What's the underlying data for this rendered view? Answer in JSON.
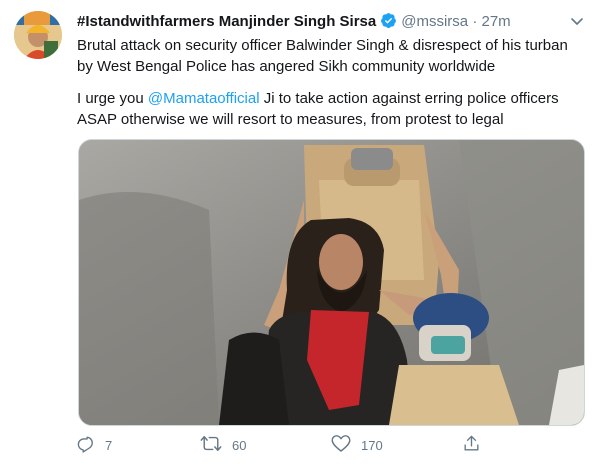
{
  "tweet": {
    "display_name": "#Istandwithfarmers Manjinder Singh Sirsa",
    "handle": "@mssirsa",
    "separator": "·",
    "time": "27m",
    "paragraph1": "Brutal attack on security officer Balwinder Singh & disrespect of his turban by West Bengal Police has angered Sikh community worldwide",
    "paragraph2_prefix": "I urge you ",
    "mention": "@Mamataofficial",
    "paragraph2_suffix": " Ji to take action against erring police officers ASAP otherwise we will resort to measures, from protest to legal"
  },
  "actions": {
    "replies": "7",
    "retweets": "60",
    "likes": "170"
  },
  "icons": {
    "verified": "verified-badge-icon",
    "caret": "chevron-down-icon",
    "reply": "reply-icon",
    "retweet": "retweet-icon",
    "like": "heart-icon",
    "share": "share-icon"
  },
  "colors": {
    "accent": "#1da1f2",
    "muted": "#657786",
    "text": "#14171a"
  }
}
